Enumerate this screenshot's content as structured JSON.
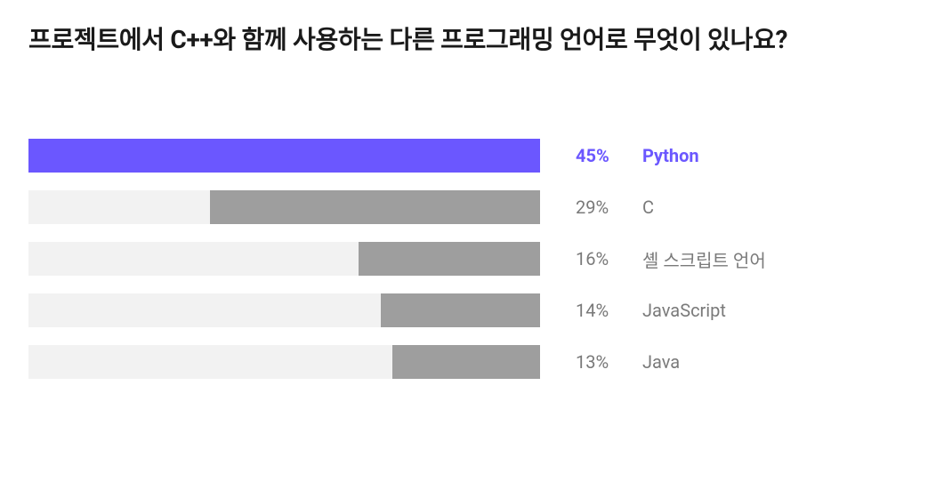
{
  "chart_data": {
    "type": "bar",
    "title": "프로젝트에서 C++와 함께 사용하는 다른 프로그래밍 언어로 무엇이 있나요?",
    "categories": [
      "Python",
      "C",
      "셸 스크립트 언어",
      "JavaScript",
      "Java"
    ],
    "values": [
      45,
      29,
      16,
      14,
      13
    ],
    "highlighted_index": 0,
    "xlabel": "",
    "ylabel": "",
    "ylim": [
      0,
      45
    ]
  },
  "rows": [
    {
      "value_text": "45%",
      "category": "Python",
      "highlighted": true
    },
    {
      "value_text": "29%",
      "category": "C",
      "highlighted": false
    },
    {
      "value_text": "16%",
      "category": "셸 스크립트 언어",
      "highlighted": false
    },
    {
      "value_text": "14%",
      "category": "JavaScript",
      "highlighted": false
    },
    {
      "value_text": "13%",
      "category": "Java",
      "highlighted": false
    }
  ]
}
